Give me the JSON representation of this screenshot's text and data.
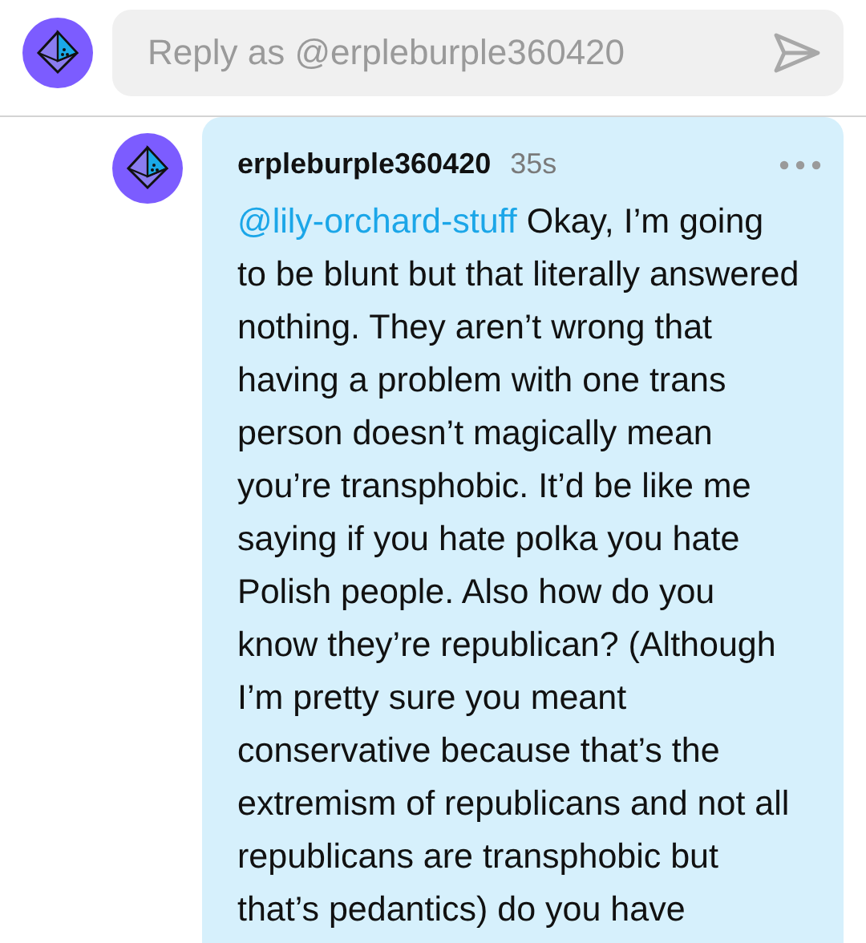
{
  "reply_field": {
    "placeholder": "Reply as @erpleburple360420"
  },
  "comment": {
    "username": "erpleburple360420",
    "time": "35s",
    "mention": "@lily-orchard-stuff",
    "text": " Okay, I’m going to be blunt but that literally answered nothing. They aren’t wrong that having a problem with one trans person doesn’t magically mean you’re transphobic. It’d be like me saying if you hate polka you hate Polish people. Also how do you know they’re republican? (Although I’m pretty sure you meant conservative because that’s the extremism of republicans and not all republicans are transphobic but that’s pedantics) do you have"
  }
}
